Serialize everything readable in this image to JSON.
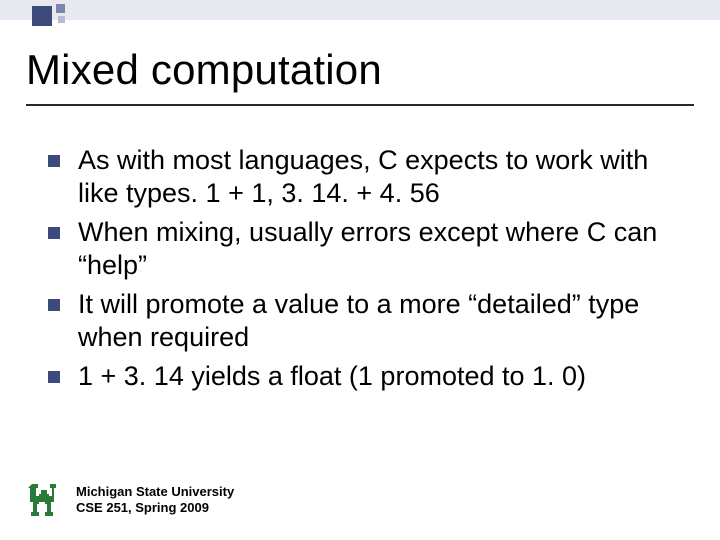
{
  "title": "Mixed computation",
  "bullets": [
    "As with most languages, C expects to work with like types. 1 + 1, 3. 14. + 4. 56",
    "When mixing, usually errors except where C can “help”",
    "It will promote a value to a more “detailed” type when required",
    "1 + 3. 14 yields a float (1 promoted to 1. 0)"
  ],
  "footer": {
    "line1": "Michigan State University",
    "line2": "CSE 251, Spring 2009"
  }
}
